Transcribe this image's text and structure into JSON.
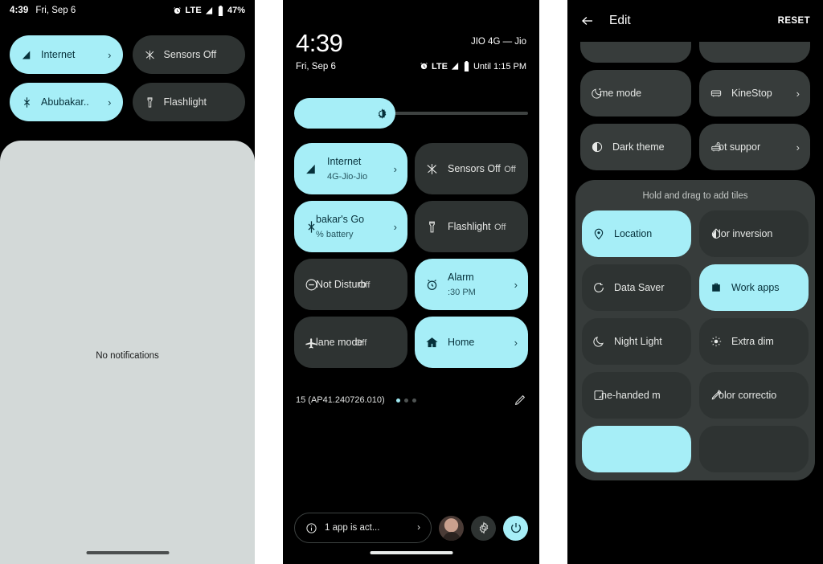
{
  "theme": {
    "accent_cyan": "#A6EEF7",
    "tile_dark": "#2E3332",
    "container_dark": "#373C3B",
    "shade_light": "#D3D9D8",
    "background": "#000000"
  },
  "panel_1": {
    "name": "notification-shade-collapsed",
    "status_bar": {
      "time": "4:39",
      "date": "Fri, Sep 6",
      "network_type": "LTE",
      "battery_percent": "47%",
      "icons": [
        "alarm-icon",
        "signal-icon",
        "battery-icon"
      ]
    },
    "quick_tiles": [
      {
        "label": "Internet",
        "icon": "signal-triangle-icon",
        "state": "on",
        "chevron": "›"
      },
      {
        "label": "Sensors Off",
        "icon": "sensors-off-icon",
        "state": "off",
        "chevron": ""
      },
      {
        "label": "Abubakar..",
        "icon": "bluetooth-icon",
        "state": "on",
        "chevron": "›"
      },
      {
        "label": "Flashlight",
        "icon": "flashlight-icon",
        "state": "off",
        "chevron": ""
      }
    ],
    "notifications": {
      "empty_text": "No notifications"
    }
  },
  "panel_2": {
    "name": "quick-settings-expanded",
    "header": {
      "clock": "4:39",
      "date": "Fri, Sep 6",
      "carrier": "JIO 4G — Jio",
      "network_type": "LTE",
      "battery_estimate": "Until 1:15 PM",
      "icons": [
        "alarm-icon",
        "signal-icon",
        "battery-icon"
      ]
    },
    "brightness": {
      "icon": "brightness-icon",
      "fill_percent": 43
    },
    "quick_tiles": [
      {
        "label": "Internet",
        "sub": "4G-Jio-Jio",
        "icon": "signal-triangle-icon",
        "state": "on",
        "chevron": "›",
        "clipped": false
      },
      {
        "label": "Sensors Off",
        "sub": "Off",
        "icon": "sensors-off-icon",
        "state": "off",
        "chevron": "",
        "clipped": false
      },
      {
        "label": "bakar's Go",
        "sub": "% battery",
        "icon": "bluetooth-icon",
        "state": "on",
        "chevron": "›",
        "clipped": true
      },
      {
        "label": "Flashlight",
        "sub": "Off",
        "icon": "flashlight-icon",
        "state": "off",
        "chevron": "",
        "clipped": false
      },
      {
        "label": "Not Disturb",
        "sub": "Off",
        "icon": "do-not-disturb-icon",
        "state": "off",
        "chevron": "",
        "clipped": true
      },
      {
        "label": "Alarm",
        "sub": ":30 PM",
        "icon": "alarm-clock-icon",
        "state": "on",
        "chevron": "›",
        "clipped": false
      },
      {
        "label": "lane mode",
        "sub": "Off",
        "icon": "airplane-icon",
        "state": "off",
        "chevron": "",
        "clipped": true
      },
      {
        "label": "Home",
        "sub": "",
        "icon": "home-icon",
        "state": "on",
        "chevron": "›",
        "clipped": false
      }
    ],
    "footer": {
      "build_label": "15 (AP41.240726.010)",
      "page_dots": 3,
      "active_dot": 1,
      "edit_icon": "pencil-icon"
    },
    "bottom_bar": {
      "active_apps_label": "1 app is act...",
      "active_apps_icon": "info-icon",
      "active_apps_chevron": "›",
      "avatar_icon": "user-avatar",
      "settings_icon": "gear-icon",
      "power_icon": "power-icon"
    }
  },
  "panel_3": {
    "name": "edit-quick-settings",
    "header": {
      "back_icon": "arrow-left-icon",
      "title": "Edit",
      "reset_label": "RESET"
    },
    "current_tiles": [
      {
        "label": "",
        "icon": "",
        "state": "off",
        "chevron": "",
        "clipped": false,
        "partial": true
      },
      {
        "label": "",
        "icon": "",
        "state": "off",
        "chevron": "",
        "clipped": false,
        "partial": true
      },
      {
        "label": "me mode",
        "icon": "bedtime-icon",
        "state": "off",
        "chevron": "",
        "clipped": true,
        "partial": false
      },
      {
        "label": "KineStop",
        "icon": "car-seat-icon",
        "state": "off",
        "chevron": "›",
        "clipped": false,
        "partial": false
      },
      {
        "label": "Dark theme",
        "icon": "contrast-icon",
        "state": "off",
        "chevron": "",
        "clipped": false,
        "partial": false
      },
      {
        "label": "ot suppor",
        "icon": "car-key-icon",
        "state": "off",
        "chevron": "›",
        "clipped": true,
        "partial": false
      }
    ],
    "add_section": {
      "hint": "Hold and drag to add tiles",
      "tiles": [
        {
          "label": "Location",
          "icon": "location-pin-icon",
          "state": "on",
          "clipped": false
        },
        {
          "label": "lor inversion",
          "icon": "invert-colors-icon",
          "state": "off",
          "clipped": true
        },
        {
          "label": "Data Saver",
          "icon": "data-saver-icon",
          "state": "off",
          "clipped": false
        },
        {
          "label": "Work apps",
          "icon": "briefcase-icon",
          "state": "on",
          "clipped": false
        },
        {
          "label": "Night Light",
          "icon": "moon-icon",
          "state": "off",
          "clipped": false
        },
        {
          "label": "Extra dim",
          "icon": "brightness-low-icon",
          "state": "off",
          "clipped": false
        },
        {
          "label": "ne-handed m",
          "icon": "one-handed-icon",
          "state": "off",
          "clipped": true
        },
        {
          "label": "olor correctio",
          "icon": "eyedropper-icon",
          "state": "off",
          "clipped": true
        },
        {
          "label": "",
          "icon": "",
          "state": "on",
          "clipped": false
        },
        {
          "label": "",
          "icon": "",
          "state": "off",
          "clipped": false
        }
      ]
    }
  }
}
